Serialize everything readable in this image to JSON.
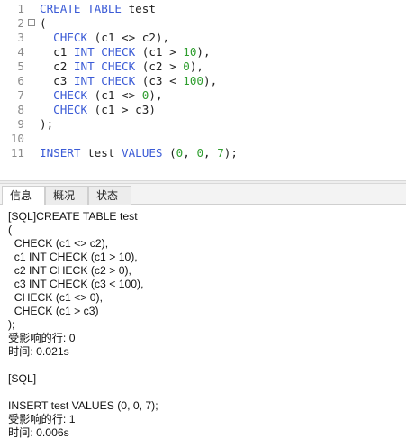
{
  "editor": {
    "line_numbers": [
      "1",
      "2",
      "3",
      "4",
      "5",
      "6",
      "7",
      "8",
      "9",
      "10",
      "11"
    ],
    "colors": {
      "keyword": "#3b5bd6",
      "number": "#2f9e2f",
      "text": "#222222"
    },
    "lines": [
      [
        {
          "k": "kw",
          "t": "CREATE TABLE"
        },
        {
          "k": "txt",
          "t": " test"
        }
      ],
      [
        {
          "k": "txt",
          "t": "("
        }
      ],
      [
        {
          "k": "txt",
          "t": "  "
        },
        {
          "k": "kw",
          "t": "CHECK"
        },
        {
          "k": "txt",
          "t": " (c1 <> c2),"
        }
      ],
      [
        {
          "k": "txt",
          "t": "  c1 "
        },
        {
          "k": "kw",
          "t": "INT CHECK"
        },
        {
          "k": "txt",
          "t": " (c1 > "
        },
        {
          "k": "num",
          "t": "10"
        },
        {
          "k": "txt",
          "t": "),"
        }
      ],
      [
        {
          "k": "txt",
          "t": "  c2 "
        },
        {
          "k": "kw",
          "t": "INT CHECK"
        },
        {
          "k": "txt",
          "t": " (c2 > "
        },
        {
          "k": "num",
          "t": "0"
        },
        {
          "k": "txt",
          "t": "),"
        }
      ],
      [
        {
          "k": "txt",
          "t": "  c3 "
        },
        {
          "k": "kw",
          "t": "INT CHECK"
        },
        {
          "k": "txt",
          "t": " (c3 < "
        },
        {
          "k": "num",
          "t": "100"
        },
        {
          "k": "txt",
          "t": "),"
        }
      ],
      [
        {
          "k": "txt",
          "t": "  "
        },
        {
          "k": "kw",
          "t": "CHECK"
        },
        {
          "k": "txt",
          "t": " (c1 <> "
        },
        {
          "k": "num",
          "t": "0"
        },
        {
          "k": "txt",
          "t": "),"
        }
      ],
      [
        {
          "k": "txt",
          "t": "  "
        },
        {
          "k": "kw",
          "t": "CHECK"
        },
        {
          "k": "txt",
          "t": " (c1 > c3)"
        }
      ],
      [
        {
          "k": "txt",
          "t": ");"
        }
      ],
      [],
      [
        {
          "k": "kw",
          "t": "INSERT"
        },
        {
          "k": "txt",
          "t": " test "
        },
        {
          "k": "kw",
          "t": "VALUES"
        },
        {
          "k": "txt",
          "t": " ("
        },
        {
          "k": "num",
          "t": "0"
        },
        {
          "k": "txt",
          "t": ", "
        },
        {
          "k": "num",
          "t": "0"
        },
        {
          "k": "txt",
          "t": ", "
        },
        {
          "k": "num",
          "t": "7"
        },
        {
          "k": "txt",
          "t": ");"
        }
      ]
    ]
  },
  "tabs": [
    {
      "label": "信息",
      "active": true
    },
    {
      "label": "概况",
      "active": false
    },
    {
      "label": "状态",
      "active": false
    }
  ],
  "output": {
    "lines": [
      "[SQL]CREATE TABLE test",
      "(",
      "  CHECK (c1 <> c2),",
      "  c1 INT CHECK (c1 > 10),",
      "  c2 INT CHECK (c2 > 0),",
      "  c3 INT CHECK (c3 < 100),",
      "  CHECK (c1 <> 0),",
      "  CHECK (c1 > c3)",
      ");",
      "受影响的行: 0",
      "时间: 0.021s",
      "",
      "[SQL]",
      "",
      "INSERT test VALUES (0, 0, 7);",
      "受影响的行: 1",
      "时间: 0.006s"
    ]
  }
}
